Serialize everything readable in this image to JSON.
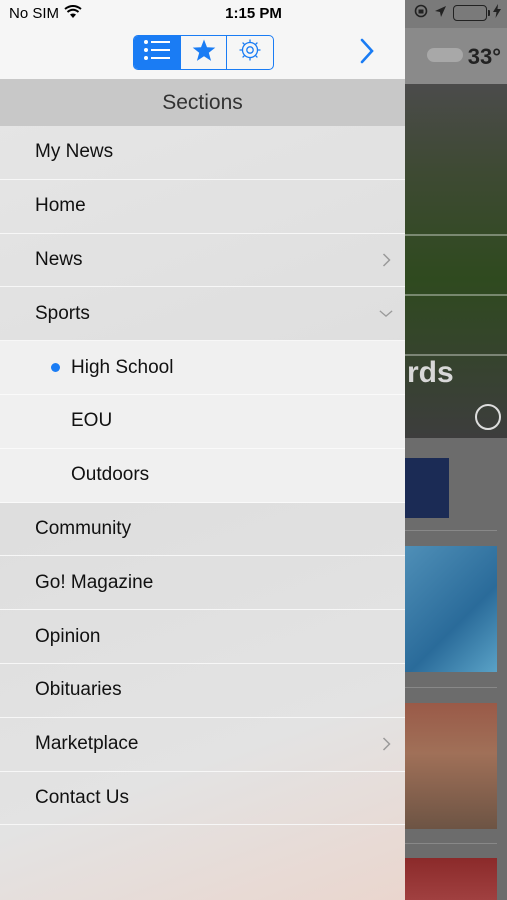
{
  "status_bar": {
    "carrier": "No SIM",
    "time": "1:15 PM",
    "battery_level": 1.0
  },
  "toolbar": {
    "segments": [
      {
        "icon": "list-icon",
        "selected": true
      },
      {
        "icon": "star-icon",
        "selected": false
      },
      {
        "icon": "gear-icon",
        "selected": false
      }
    ],
    "forward_icon": "chevron-right-icon"
  },
  "sections_title": "Sections",
  "menu": {
    "items": [
      {
        "label": "My News"
      },
      {
        "label": "Home"
      },
      {
        "label": "News",
        "chevron": "right"
      },
      {
        "label": "Sports",
        "chevron": "down"
      },
      {
        "label": "High School",
        "sub": true,
        "selected": true
      },
      {
        "label": "EOU",
        "sub": true
      },
      {
        "label": "Outdoors",
        "sub": true
      },
      {
        "label": "Community"
      },
      {
        "label": "Go! Magazine"
      },
      {
        "label": "Opinion"
      },
      {
        "label": "Obituaries"
      },
      {
        "label": "Marketplace",
        "chevron": "right"
      },
      {
        "label": "Contact Us"
      }
    ]
  },
  "background": {
    "temperature": "33°",
    "hero_text": "rds"
  },
  "colors": {
    "accent": "#1a7cf4",
    "battery": "#4cd964"
  }
}
